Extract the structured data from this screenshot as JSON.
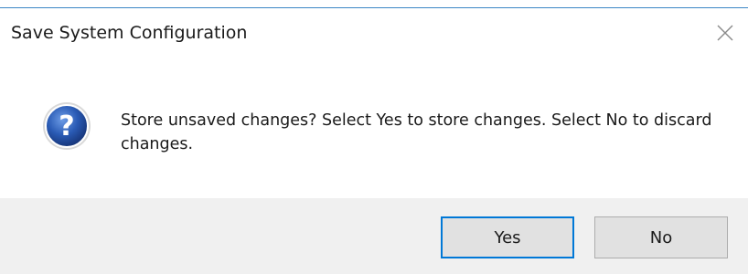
{
  "dialog": {
    "title": "Save System Configuration",
    "message": "Store unsaved changes? Select Yes to store changes. Select No to discard changes.",
    "icon": "question-icon",
    "buttons": {
      "yes_label": "Yes",
      "no_label": "No",
      "default": "yes"
    }
  },
  "colors": {
    "footer_background": "#f0f0f0",
    "button_background": "#e1e1e1",
    "default_button_border": "#0078d7",
    "icon_blue": "#2a5bb5"
  }
}
